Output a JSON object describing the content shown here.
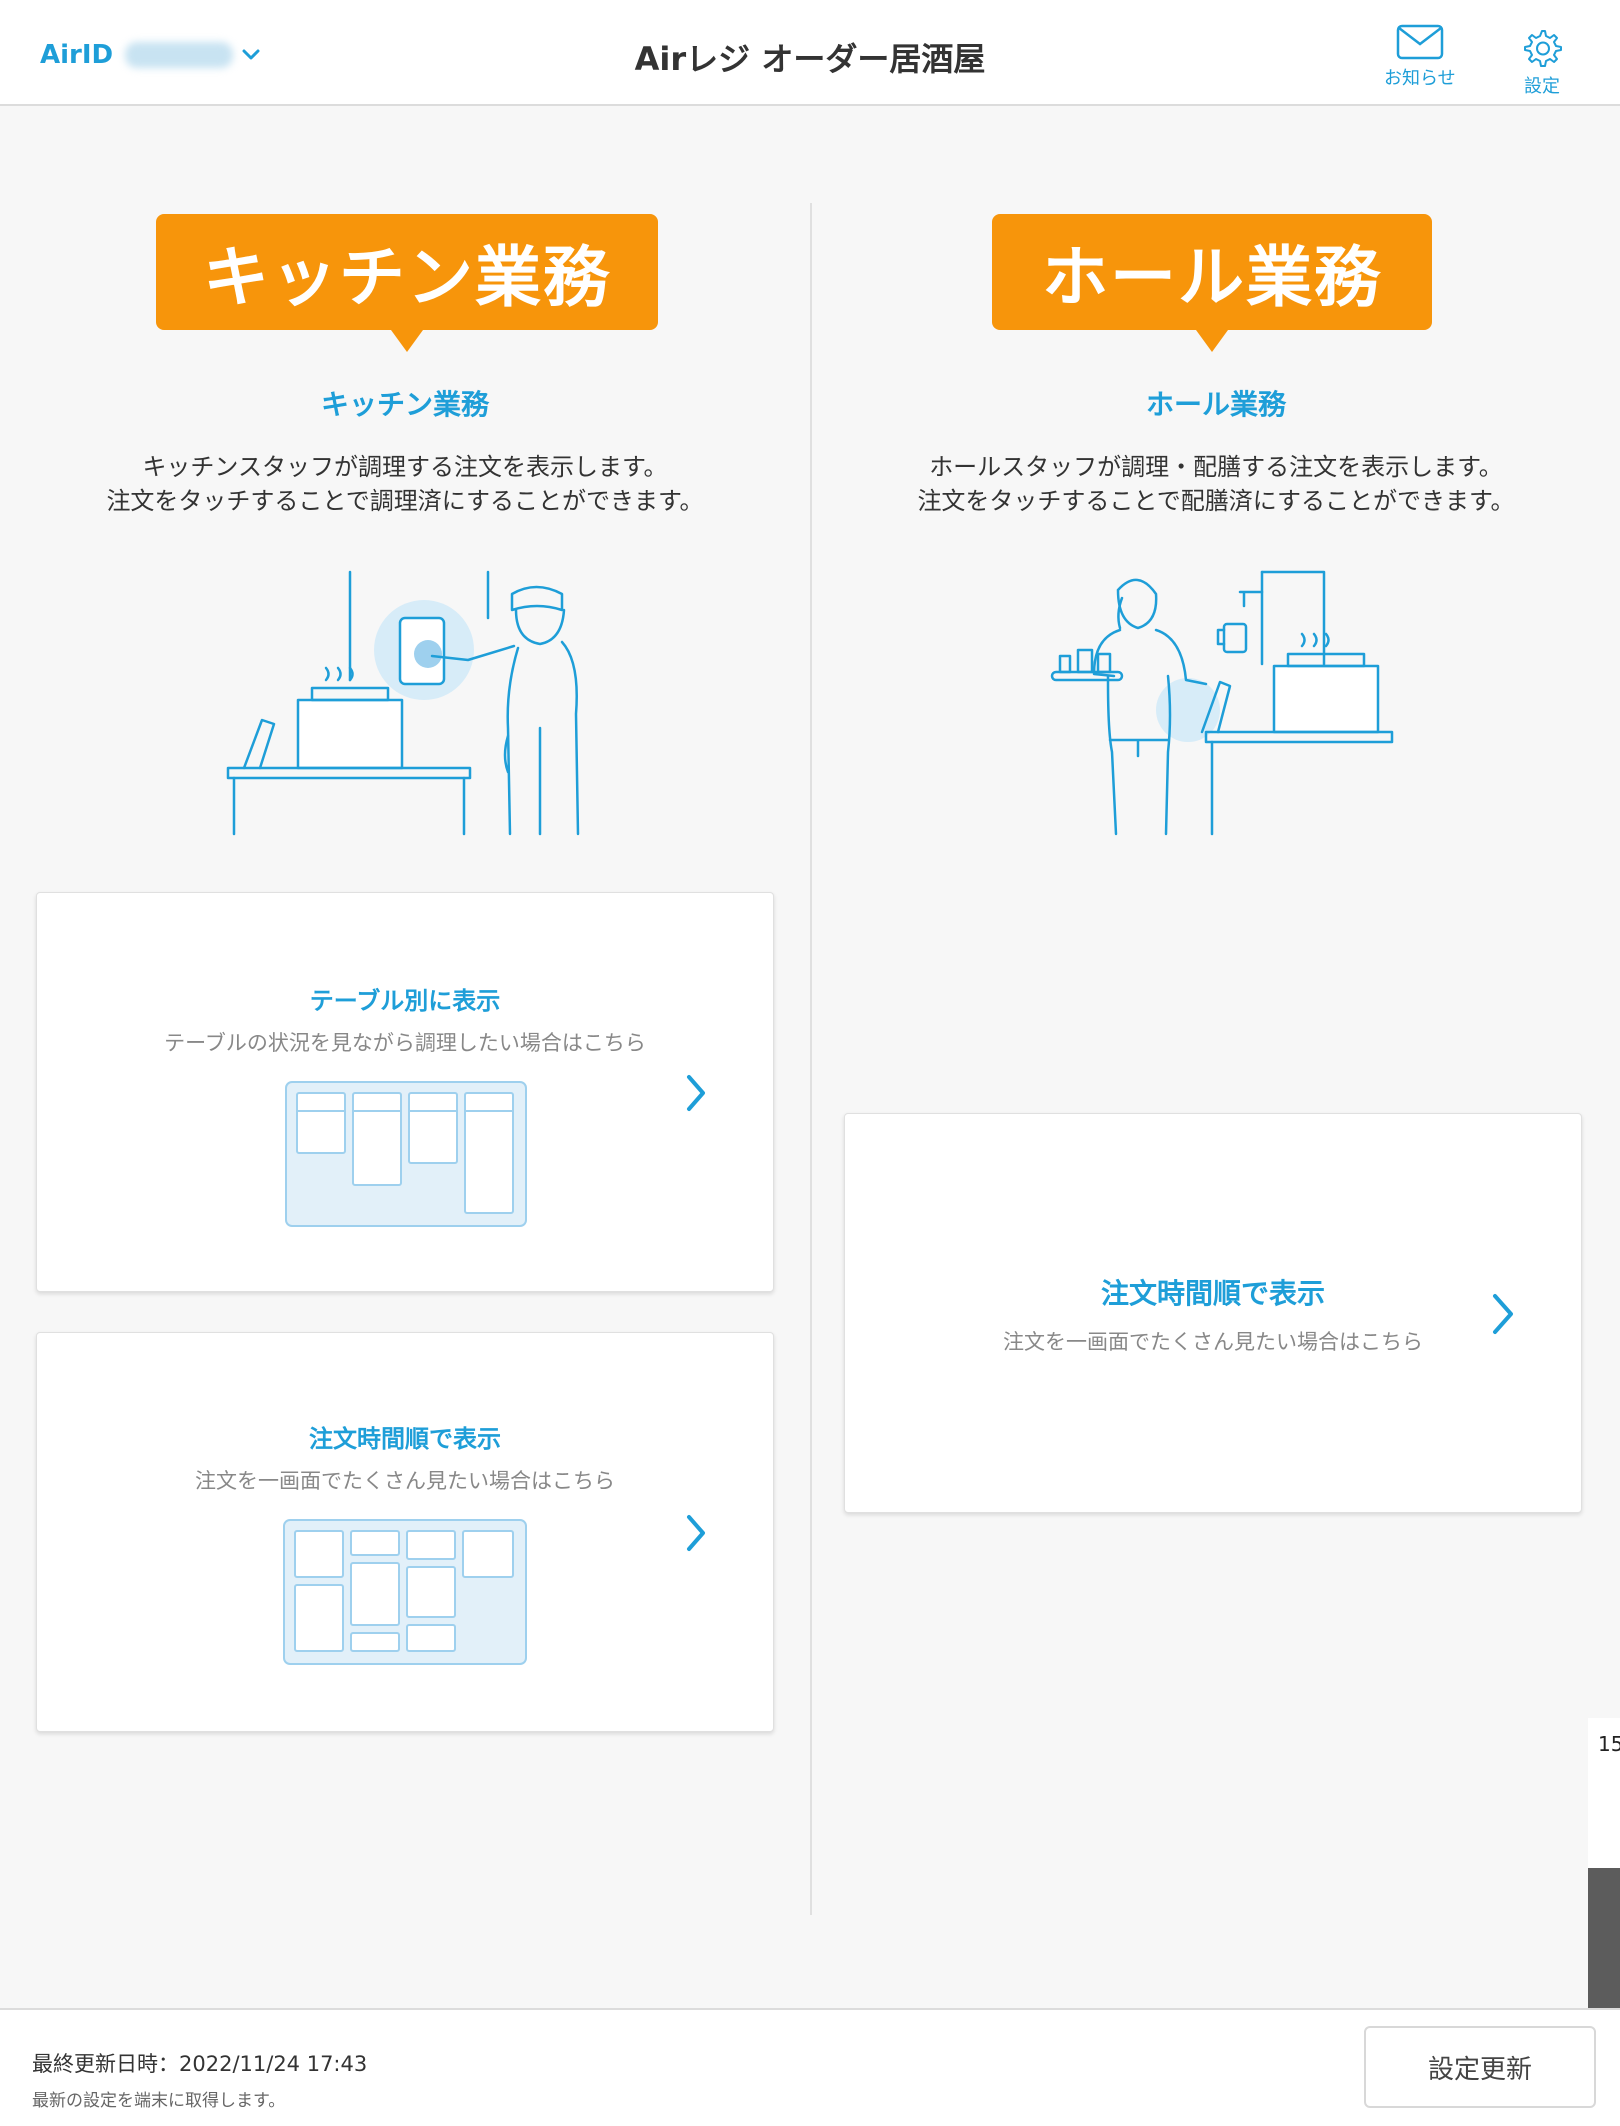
{
  "header": {
    "airid_label": "AirID",
    "title": "Airレジ オーダー居酒屋",
    "notifications_label": "お知らせ",
    "settings_label": "設定"
  },
  "kitchen": {
    "banner": "キッチン業務",
    "title": "キッチン業務",
    "desc_line1": "キッチンスタッフが調理する注文を表示します。",
    "desc_line2": "注文をタッチすることで調理済にすることができます。",
    "cards": [
      {
        "title": "テーブル別に表示",
        "sub": "テーブルの状況を見ながら調理したい場合はこちら"
      },
      {
        "title": "注文時間順で表示",
        "sub": "注文を一画面でたくさん見たい場合はこちら"
      }
    ]
  },
  "hall": {
    "banner": "ホール業務",
    "title": "ホール業務",
    "desc_line1": "ホールスタッフが調理・配膳する注文を表示します。",
    "desc_line2": "注文をタッチすることで配膳済にすることができます。",
    "cards": [
      {
        "title": "注文時間順で表示",
        "sub": "注文を一画面でたくさん見たい場合はこちら"
      }
    ]
  },
  "footer": {
    "last_updated": "最終更新日時：2022/11/24 17:43",
    "note": "最新の設定を端末に取得します。",
    "update_button": "設定更新"
  },
  "edge_number": "15",
  "colors": {
    "accent": "#1e9ed8",
    "banner": "#f7950b",
    "background": "#f7f7f7"
  }
}
